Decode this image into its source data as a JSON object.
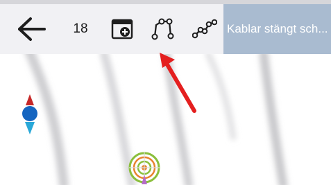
{
  "toolbar": {
    "back_icon": "arrow-left-icon",
    "count_value": "18",
    "layer_icon": "calendar-plus-icon",
    "route_icon": "route-polyline-icon",
    "track_icon": "track-polyline-icon",
    "banner_text": "Kablar stängt sch..."
  },
  "map": {
    "compass_icon": "compass-icon",
    "locator_icon": "target-location-icon"
  },
  "annotation": {
    "arrow_icon": "red-pointer-arrow-icon"
  },
  "colors": {
    "toolbar_bg": "#f1f1f4",
    "banner_bg": "#a9bbd0",
    "icon_dark": "#1e1e1e",
    "compass_red": "#c62828",
    "compass_blue": "#1565c0",
    "compass_cyan": "#2aa8d8",
    "arrow_red": "#e41f1f",
    "locator_green": "#8bbf3c",
    "locator_orange": "#e8832f"
  }
}
